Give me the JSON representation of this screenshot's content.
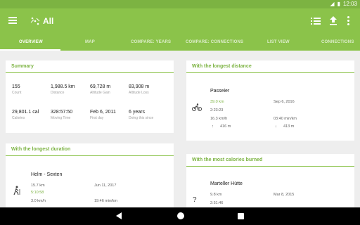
{
  "status_bar": {
    "time": "12:03"
  },
  "app_bar": {
    "title": "All"
  },
  "tabs": [
    {
      "label": "OVERVIEW"
    },
    {
      "label": "MAP"
    },
    {
      "label": "COMPARE: YEARS"
    },
    {
      "label": "COMPARE: CONNECTIONS"
    },
    {
      "label": "LIST VIEW"
    },
    {
      "label": "CONNECTIONS"
    }
  ],
  "summary": {
    "title": "Summary",
    "stats": [
      {
        "value": "155",
        "label": "Count"
      },
      {
        "value": "1,988.5 km",
        "label": "Distance"
      },
      {
        "value": "69,728 m",
        "label": "Altitude Gain"
      },
      {
        "value": "83,908 m",
        "label": "Altitude Loss"
      },
      {
        "value": "29,801.1 cal",
        "label": "Calories"
      },
      {
        "value": "328:57:50",
        "label": "Moving Time"
      },
      {
        "value": "Feb 6, 2011",
        "label": "First day"
      },
      {
        "value": "6 years",
        "label": "Doing this since"
      }
    ]
  },
  "longest_distance": {
    "title": "With the longest distance",
    "name": "Passeier",
    "highlight": "39.0 km",
    "date": "Sep 6, 2016",
    "duration": "2:23:23",
    "speed": "16.3 km/h",
    "pace": "03:40 min/km",
    "gain": "416 m",
    "loss": "413 m",
    "icon": "bike-icon"
  },
  "longest_duration": {
    "title": "With the longest duration",
    "name": "Helm - Sexten",
    "distance": "15.7 km",
    "date": "Jun 11, 2017",
    "highlight": "5:10:58",
    "speed": "3.0 km/h",
    "pace": "19:46 min/km",
    "icon": "hiking-icon"
  },
  "most_calories": {
    "title": "With the most calories burned",
    "name": "Marteller Hütte",
    "distance": "9.8 km",
    "date": "Mar 8, 2015",
    "duration": "2:51:46",
    "icon": "question-icon"
  },
  "colors": {
    "accent": "#8bc34a",
    "status_bar": "#7cb342"
  }
}
